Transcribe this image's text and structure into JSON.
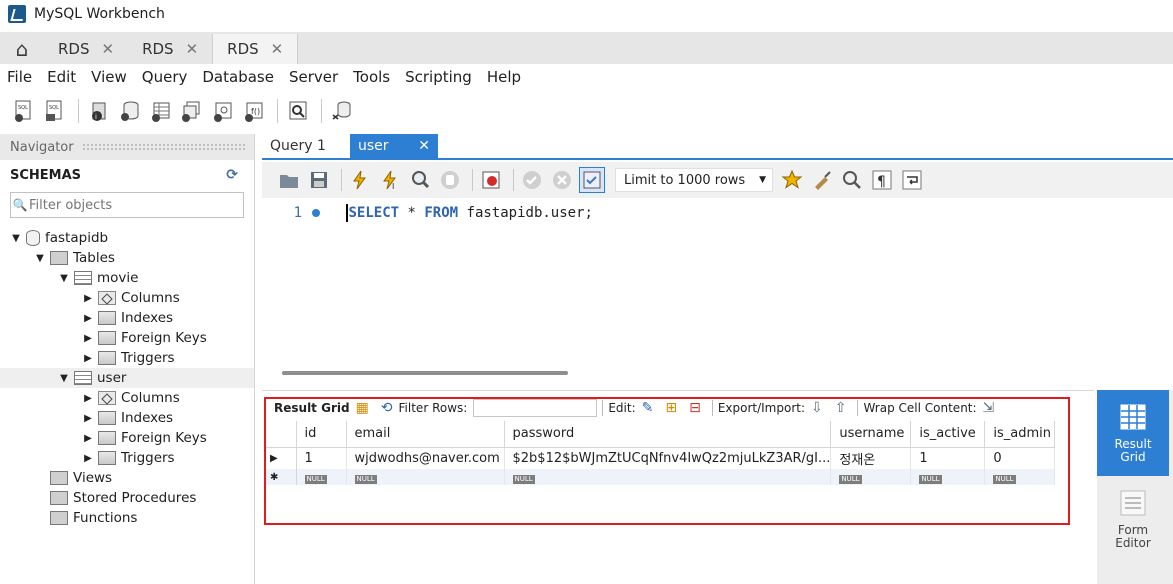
{
  "window": {
    "title": "MySQL Workbench"
  },
  "connection_tabs": [
    {
      "label": "RDS",
      "active": false
    },
    {
      "label": "RDS",
      "active": false
    },
    {
      "label": "RDS",
      "active": true
    }
  ],
  "menu": [
    "File",
    "Edit",
    "View",
    "Query",
    "Database",
    "Server",
    "Tools",
    "Scripting",
    "Help"
  ],
  "navigator": {
    "header": "Navigator",
    "schemas_label": "SCHEMAS",
    "filter_placeholder": "Filter objects",
    "tree": {
      "schema": "fastapidb",
      "tables_label": "Tables",
      "tables": [
        {
          "name": "movie",
          "children": [
            "Columns",
            "Indexes",
            "Foreign Keys",
            "Triggers"
          ]
        },
        {
          "name": "user",
          "children": [
            "Columns",
            "Indexes",
            "Foreign Keys",
            "Triggers"
          ]
        }
      ],
      "views_label": "Views",
      "procedures_label": "Stored Procedures",
      "functions_label": "Functions"
    }
  },
  "editor": {
    "tabs": [
      {
        "label": "Query 1",
        "active": false
      },
      {
        "label": "user",
        "active": true
      }
    ],
    "limit_label": "Limit to 1000 rows",
    "line_number": "1",
    "sql": {
      "kw1": "SELECT",
      "mid": " * ",
      "kw2": "FROM",
      "rest": " fastapidb.user;"
    }
  },
  "result_grid": {
    "title": "Result Grid",
    "filter_label": "Filter Rows:",
    "edit_label": "Edit:",
    "export_label": "Export/Import:",
    "wrap_label": "Wrap Cell Content:",
    "columns": [
      "id",
      "email",
      "password",
      "username",
      "is_active",
      "is_admin"
    ],
    "rows": [
      [
        "1",
        "wjdwodhs@naver.com",
        "$2b$12$bWJmZtUCqNfnv4IwQz2mjuLkZ3AR/gI...",
        "정재온",
        "1",
        "0"
      ]
    ],
    "null_label": "NULL"
  },
  "side_panel": {
    "result_grid_label": "Result Grid",
    "form_editor_label": "Form Editor"
  },
  "colors": {
    "accent": "#2d7fd3",
    "highlight": "#e21c1c"
  }
}
